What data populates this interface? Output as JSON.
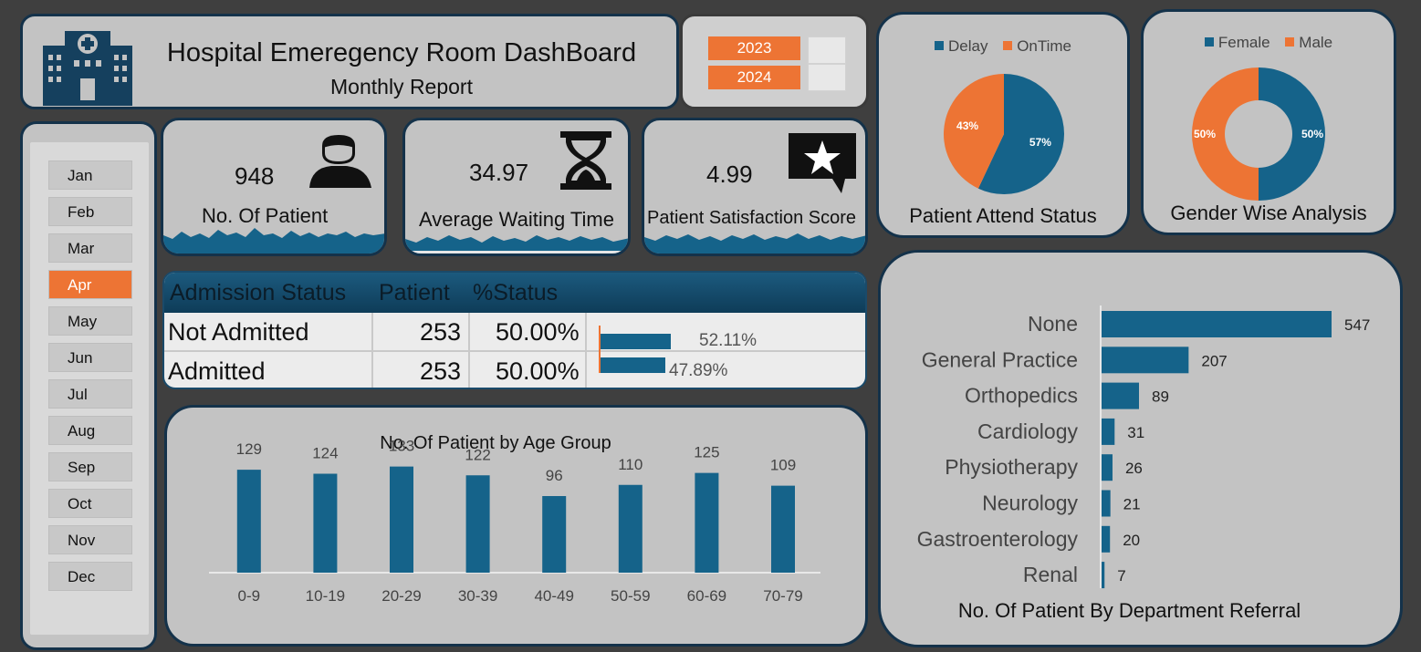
{
  "header": {
    "title": "Hospital Emeregency Room DashBoard",
    "subtitle": "Monthly Report"
  },
  "year_slicer": {
    "options": [
      "2023",
      "2024"
    ]
  },
  "month_slicer": {
    "items": [
      "Jan",
      "Feb",
      "Mar",
      "Apr",
      "May",
      "Jun",
      "Jul",
      "Aug",
      "Sep",
      "Oct",
      "Nov",
      "Dec"
    ],
    "selected": "Apr"
  },
  "kpis": {
    "patients": {
      "value": "948",
      "label": "No. Of Patient",
      "icon": "patient-icon"
    },
    "waiting": {
      "value": "34.97",
      "label": "Average Waiting Time",
      "icon": "hourglass-icon"
    },
    "satisfaction": {
      "value": "4.99",
      "label": "Patient Satisfaction Score",
      "icon": "star-speech-icon"
    }
  },
  "admission": {
    "headers": [
      "Admission Status",
      "Patient",
      "%Status"
    ],
    "rows": [
      {
        "status": "Not Admitted",
        "patient": "253",
        "pct_status": "50.00%",
        "bar_label": "52.11%",
        "bar_value": 52.11
      },
      {
        "status": "Admitted",
        "patient": "253",
        "pct_status": "50.00%",
        "bar_label": "47.89%",
        "bar_value": 47.89
      }
    ]
  },
  "colors": {
    "primary": "#15638a",
    "accent": "#ed7434",
    "panel_border": "#14324a",
    "panel_bg": "#c3c3c3",
    "background": "#3f3f3f"
  },
  "chart_data": [
    {
      "type": "pie",
      "title": "Patient Attend Status",
      "legend": [
        "Delay",
        "OnTime"
      ],
      "legend_position": "top",
      "slices": [
        {
          "name": "Delay",
          "value": 57,
          "label": "57%",
          "color": "#15638a"
        },
        {
          "name": "OnTime",
          "value": 43,
          "label": "43%",
          "color": "#ed7434"
        }
      ]
    },
    {
      "type": "pie",
      "subtype": "donut",
      "title": "Gender Wise Analysis",
      "legend": [
        "Female",
        "Male"
      ],
      "legend_position": "top",
      "slices": [
        {
          "name": "Female",
          "value": 50,
          "label": "50%",
          "color": "#15638a"
        },
        {
          "name": "Male",
          "value": 50,
          "label": "50%",
          "color": "#ed7434"
        }
      ]
    },
    {
      "type": "bar",
      "title": "No. Of Patient by Age Group",
      "categories": [
        "0-9",
        "10-19",
        "20-29",
        "30-39",
        "40-49",
        "50-59",
        "60-69",
        "70-79"
      ],
      "values": [
        129,
        124,
        133,
        122,
        96,
        110,
        125,
        109
      ],
      "xlabel": "",
      "ylabel": "",
      "color": "#15638a"
    },
    {
      "type": "bar",
      "orientation": "horizontal",
      "title": "No. Of Patient By Department Referral",
      "categories": [
        "None",
        "General Practice",
        "Orthopedics",
        "Cardiology",
        "Physiotherapy",
        "Neurology",
        "Gastroenterology",
        "Renal"
      ],
      "values": [
        547,
        207,
        89,
        31,
        26,
        21,
        20,
        7
      ],
      "color": "#15638a"
    }
  ]
}
